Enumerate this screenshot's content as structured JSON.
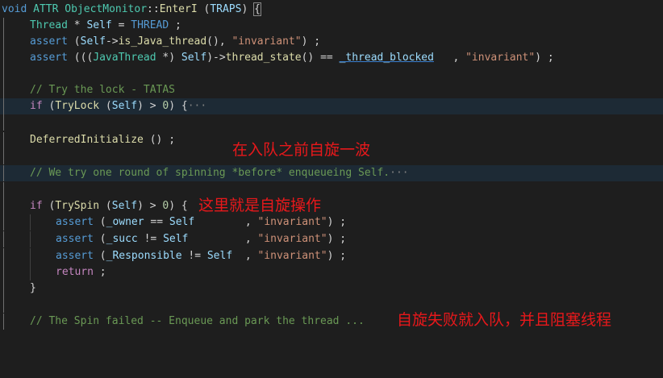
{
  "editor": {
    "colors": {
      "background": "#1e1e1e",
      "highlight_line": "#1d2a35",
      "annotation": "#e8181b"
    },
    "line1": {
      "t1": "void",
      "t2": "ATTR",
      "t3": "ObjectMonitor",
      "t4": "::",
      "t5": "EnterI",
      "t6": "(",
      "t7": "TRAPS",
      "t8": ")",
      "t9": "{"
    },
    "line2": {
      "t1": "Thread",
      "t2": " * ",
      "t3": "Self",
      "t4": " = ",
      "t5": "THREAD",
      "t6": " ;"
    },
    "line3": {
      "t1": "assert",
      "t2": " (",
      "t3": "Self",
      "t4": "->",
      "t5": "is_Java_thread",
      "t6": "(), ",
      "t7": "\"invariant\"",
      "t8": ") ;"
    },
    "line4": {
      "t1": "assert",
      "t2": " (((",
      "t3": "JavaThread",
      "t4": " *) ",
      "t5": "Self",
      "t6": ")->",
      "t7": "thread_state",
      "t8": "() == ",
      "t9": "_thread_blocked",
      "t10": "   , ",
      "t11": "\"invariant\"",
      "t12": ") ;"
    },
    "line6": {
      "t1": "// Try the lock - TATAS"
    },
    "line7": {
      "t1": "if",
      "t2": " (",
      "t3": "TryLock",
      "t4": " (",
      "t5": "Self",
      "t6": ") > ",
      "t7": "0",
      "t8": ") {",
      "t9": "···"
    },
    "line9": {
      "t1": "DeferredInitialize",
      "t2": " () ;"
    },
    "line11": {
      "t1": "// We try one round of spinning *before* enqueueing Self.",
      "t2": "···"
    },
    "line13": {
      "t1": "if",
      "t2": " (",
      "t3": "TrySpin",
      "t4": " (",
      "t5": "Self",
      "t6": ") > ",
      "t7": "0",
      "t8": ") {"
    },
    "line14": {
      "t1": "assert",
      "t2": " (",
      "t3": "_owner",
      "t4": " == ",
      "t5": "Self",
      "t6": "        , ",
      "t7": "\"invariant\"",
      "t8": ") ;"
    },
    "line15": {
      "t1": "assert",
      "t2": " (",
      "t3": "_succ",
      "t4": " != ",
      "t5": "Self",
      "t6": "         , ",
      "t7": "\"invariant\"",
      "t8": ") ;"
    },
    "line16": {
      "t1": "assert",
      "t2": " (",
      "t3": "_Responsible",
      "t4": " != ",
      "t5": "Self",
      "t6": "  , ",
      "t7": "\"invariant\"",
      "t8": ") ;"
    },
    "line17": {
      "t1": "return",
      "t2": " ;"
    },
    "line18": {
      "t1": "}"
    },
    "line20": {
      "t1": "// The Spin failed -- Enqueue and park the thread ..."
    }
  },
  "annotations": {
    "a1": "在入队之前自旋一波",
    "a2": "这里就是自旋操作",
    "a3": "自旋失败就入队，并且阻塞线程"
  }
}
